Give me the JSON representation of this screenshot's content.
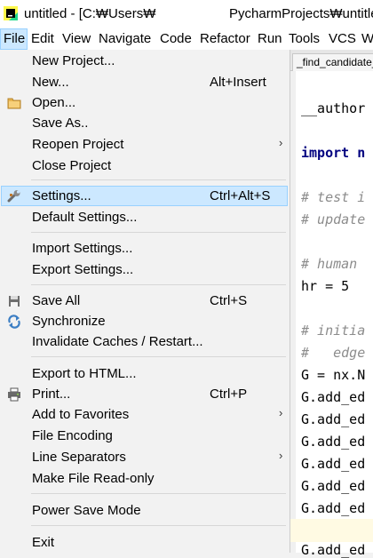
{
  "window": {
    "title_left": "untitled - [C:₩Users₩",
    "title_right": "PycharmProjects₩untitle"
  },
  "menubar": {
    "items": [
      "File",
      "Edit",
      "View",
      "Navigate",
      "Code",
      "Refactor",
      "Run",
      "Tools",
      "VCS",
      "W"
    ]
  },
  "editor": {
    "tab_label": "_find_candidate_",
    "lines": [
      "__author",
      "import n",
      "# test i",
      "# update",
      "# human",
      "hr = 5",
      "# initia",
      "#   edge",
      "G = nx.N",
      "G.add_ed",
      "G.add_ed",
      "G.add_ed",
      "G.add_ed",
      "G.add_ed",
      "G.add_ed",
      "G.add_ed"
    ]
  },
  "file_menu": {
    "items": [
      {
        "label": "New Project...",
        "shortcut": ""
      },
      {
        "label": "New...",
        "shortcut": "Alt+Insert"
      },
      {
        "label": "Open...",
        "shortcut": "",
        "icon": "folder-icon"
      },
      {
        "label": "Save As..",
        "shortcut": ""
      },
      {
        "label": "Reopen Project",
        "shortcut": "",
        "submenu": true
      },
      {
        "label": "Close Project",
        "shortcut": ""
      },
      {
        "label": "Settings...",
        "shortcut": "Ctrl+Alt+S",
        "icon": "wrench-icon",
        "highlighted": true
      },
      {
        "label": "Default Settings...",
        "shortcut": ""
      },
      {
        "label": "Import Settings...",
        "shortcut": ""
      },
      {
        "label": "Export Settings...",
        "shortcut": ""
      },
      {
        "label": "Save All",
        "shortcut": "Ctrl+S",
        "icon": "save-all-icon"
      },
      {
        "label": "Synchronize",
        "shortcut": "",
        "icon": "synchronize-icon"
      },
      {
        "label": "Invalidate Caches / Restart...",
        "shortcut": ""
      },
      {
        "label": "Export to HTML...",
        "shortcut": ""
      },
      {
        "label": "Print...",
        "shortcut": "Ctrl+P",
        "icon": "printer-icon"
      },
      {
        "label": "Add to Favorites",
        "shortcut": "",
        "submenu": true
      },
      {
        "label": "File Encoding",
        "shortcut": ""
      },
      {
        "label": "Line Separators",
        "shortcut": "",
        "submenu": true
      },
      {
        "label": "Make File Read-only",
        "shortcut": ""
      },
      {
        "label": "Power Save Mode",
        "shortcut": ""
      },
      {
        "label": "Exit",
        "shortcut": ""
      }
    ]
  },
  "colors": {
    "highlight_bg": "#cce8ff",
    "highlight_border": "#99d1ff",
    "menu_bg": "#f2f2f2",
    "comment": "#8c8c8c"
  }
}
